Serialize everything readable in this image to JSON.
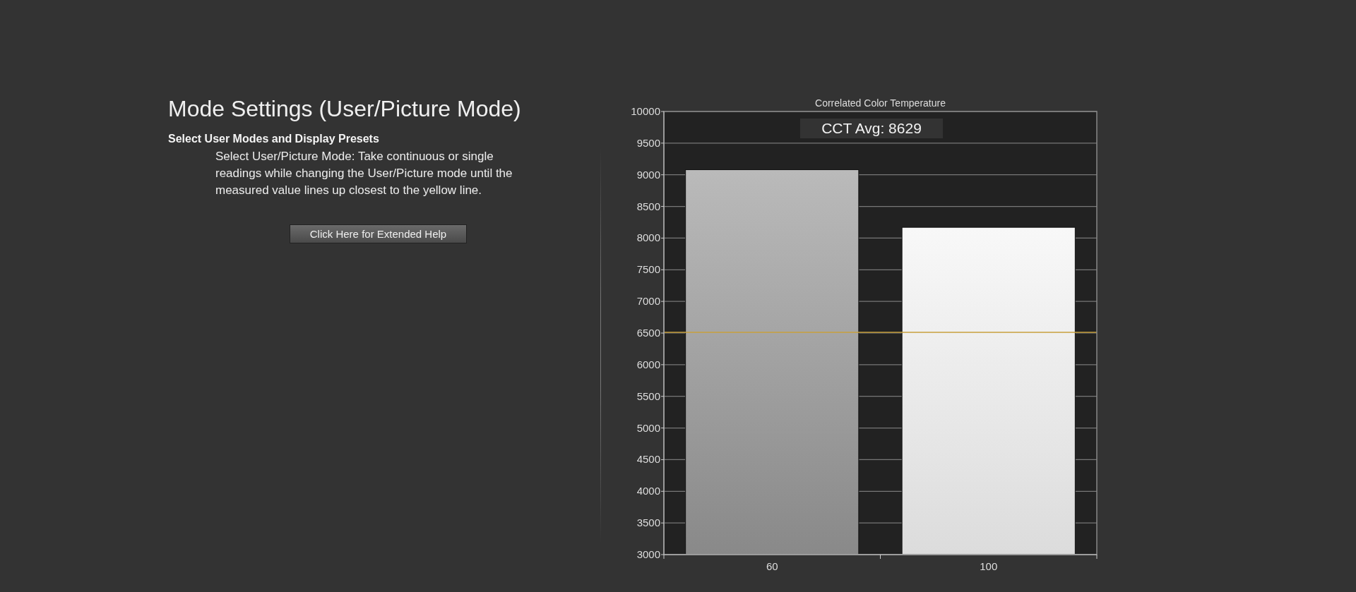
{
  "heading": "Mode Settings (User/Picture Mode)",
  "subheading": "Select User Modes and Display Presets",
  "description": "Select User/Picture Mode: Take continuous or single readings while changing the User/Picture mode until the measured value lines up closest to the yellow line.",
  "help_button": "Click Here for Extended Help",
  "chart_data": {
    "type": "bar",
    "title": "Correlated Color Temperature",
    "categories": [
      "60",
      "100"
    ],
    "values": [
      9080,
      8170
    ],
    "grid": true,
    "ref_lines": [
      {
        "axis": "y",
        "value": 6510,
        "color": "#c8a03c"
      }
    ],
    "ylim": [
      3000,
      10000
    ],
    "yticks": [
      3000,
      3500,
      4000,
      4500,
      5000,
      5500,
      6000,
      6500,
      7000,
      7500,
      8000,
      8500,
      9000,
      9500,
      10000
    ],
    "annotations": [
      {
        "text": "CCT Avg: 8629"
      }
    ]
  }
}
